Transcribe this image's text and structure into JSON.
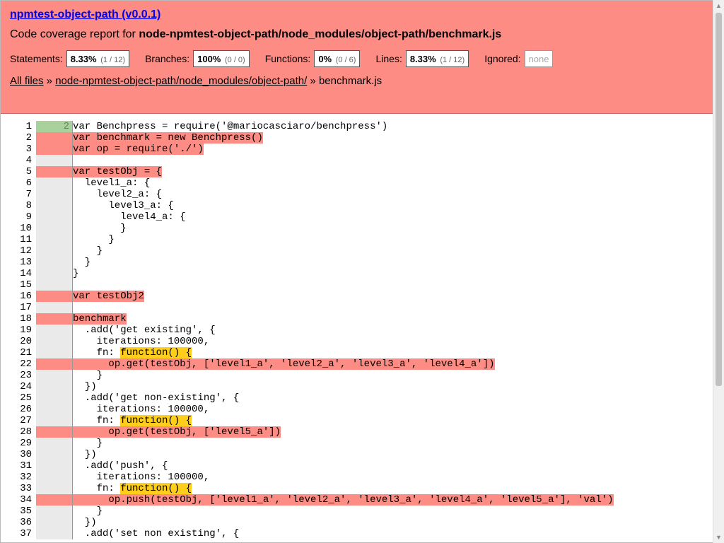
{
  "header": {
    "title": "npmtest-object-path (v0.0.1)",
    "report_prefix": "Code coverage report for ",
    "report_path": "node-npmtest-object-path/node_modules/object-path/benchmark.js"
  },
  "stats": {
    "statements": {
      "label": "Statements:",
      "pct": "8.33%",
      "frac": "(1 / 12)"
    },
    "branches": {
      "label": "Branches:",
      "pct": "100%",
      "frac": "(0 / 0)"
    },
    "functions": {
      "label": "Functions:",
      "pct": "0%",
      "frac": "(0 / 6)"
    },
    "lines": {
      "label": "Lines:",
      "pct": "8.33%",
      "frac": "(1 / 12)"
    },
    "ignored": {
      "label": "Ignored:",
      "value": "none"
    }
  },
  "breadcrumb": {
    "all_files": "All files",
    "sep1": " » ",
    "dir": "node-npmtest-object-path/node_modules/object-path/",
    "sep2": " » ",
    "file": "benchmark.js"
  },
  "colors": {
    "header_bg": "#fc8c84",
    "uncovered": "#fc8c84",
    "covered": "#a8d19b",
    "fn_uncovered": "#ffce1c",
    "link": "#0000ee"
  },
  "code_lines": [
    {
      "n": "1",
      "hits": "2",
      "status": "covered",
      "segs": [
        {
          "t": "var Benchpress = require('@mariocasciaro/benchpress')",
          "h": ""
        }
      ]
    },
    {
      "n": "2",
      "hits": "",
      "status": "uncovered",
      "segs": [
        {
          "t": "var benchmark = new Benchpress()",
          "h": "red"
        }
      ]
    },
    {
      "n": "3",
      "hits": "",
      "status": "uncovered",
      "segs": [
        {
          "t": "var op = require('./')",
          "h": "red"
        }
      ]
    },
    {
      "n": "4",
      "hits": "",
      "status": "skip",
      "segs": [
        {
          "t": "",
          "h": ""
        }
      ]
    },
    {
      "n": "5",
      "hits": "",
      "status": "uncovered",
      "segs": [
        {
          "t": "var testObj = {",
          "h": "red"
        }
      ]
    },
    {
      "n": "6",
      "hits": "",
      "status": "skip",
      "segs": [
        {
          "t": "  level1_a: {",
          "h": ""
        }
      ]
    },
    {
      "n": "7",
      "hits": "",
      "status": "skip",
      "segs": [
        {
          "t": "    level2_a: {",
          "h": ""
        }
      ]
    },
    {
      "n": "8",
      "hits": "",
      "status": "skip",
      "segs": [
        {
          "t": "      level3_a: {",
          "h": ""
        }
      ]
    },
    {
      "n": "9",
      "hits": "",
      "status": "skip",
      "segs": [
        {
          "t": "        level4_a: {",
          "h": ""
        }
      ]
    },
    {
      "n": "10",
      "hits": "",
      "status": "skip",
      "segs": [
        {
          "t": "        }",
          "h": ""
        }
      ]
    },
    {
      "n": "11",
      "hits": "",
      "status": "skip",
      "segs": [
        {
          "t": "      }",
          "h": ""
        }
      ]
    },
    {
      "n": "12",
      "hits": "",
      "status": "skip",
      "segs": [
        {
          "t": "    }",
          "h": ""
        }
      ]
    },
    {
      "n": "13",
      "hits": "",
      "status": "skip",
      "segs": [
        {
          "t": "  }",
          "h": ""
        }
      ]
    },
    {
      "n": "14",
      "hits": "",
      "status": "skip",
      "segs": [
        {
          "t": "}",
          "h": ""
        }
      ]
    },
    {
      "n": "15",
      "hits": "",
      "status": "skip",
      "segs": [
        {
          "t": "",
          "h": ""
        }
      ]
    },
    {
      "n": "16",
      "hits": "",
      "status": "uncovered",
      "segs": [
        {
          "t": "var testObj2",
          "h": "red"
        }
      ]
    },
    {
      "n": "17",
      "hits": "",
      "status": "skip",
      "segs": [
        {
          "t": "",
          "h": ""
        }
      ]
    },
    {
      "n": "18",
      "hits": "",
      "status": "uncovered",
      "segs": [
        {
          "t": "benchmark",
          "h": "red"
        }
      ]
    },
    {
      "n": "19",
      "hits": "",
      "status": "skip",
      "segs": [
        {
          "t": "  .add('get existing', {",
          "h": ""
        }
      ]
    },
    {
      "n": "20",
      "hits": "",
      "status": "skip",
      "segs": [
        {
          "t": "    iterations: 100000,",
          "h": ""
        }
      ]
    },
    {
      "n": "21",
      "hits": "",
      "status": "skip",
      "segs": [
        {
          "t": "    fn: ",
          "h": ""
        },
        {
          "t": "function() {",
          "h": "yellow"
        }
      ]
    },
    {
      "n": "22",
      "hits": "",
      "status": "uncovered",
      "segs": [
        {
          "t": "      op.get(testObj, ['level1_a', 'level2_a', 'level3_a', 'level4_a'])",
          "h": "red"
        }
      ]
    },
    {
      "n": "23",
      "hits": "",
      "status": "skip",
      "segs": [
        {
          "t": "    }",
          "h": ""
        }
      ]
    },
    {
      "n": "24",
      "hits": "",
      "status": "skip",
      "segs": [
        {
          "t": "  })",
          "h": ""
        }
      ]
    },
    {
      "n": "25",
      "hits": "",
      "status": "skip",
      "segs": [
        {
          "t": "  .add('get non-existing', {",
          "h": ""
        }
      ]
    },
    {
      "n": "26",
      "hits": "",
      "status": "skip",
      "segs": [
        {
          "t": "    iterations: 100000,",
          "h": ""
        }
      ]
    },
    {
      "n": "27",
      "hits": "",
      "status": "skip",
      "segs": [
        {
          "t": "    fn: ",
          "h": ""
        },
        {
          "t": "function() {",
          "h": "yellow"
        }
      ]
    },
    {
      "n": "28",
      "hits": "",
      "status": "uncovered",
      "segs": [
        {
          "t": "      op.get(testObj, ['level5_a'])",
          "h": "red"
        }
      ]
    },
    {
      "n": "29",
      "hits": "",
      "status": "skip",
      "segs": [
        {
          "t": "    }",
          "h": ""
        }
      ]
    },
    {
      "n": "30",
      "hits": "",
      "status": "skip",
      "segs": [
        {
          "t": "  })",
          "h": ""
        }
      ]
    },
    {
      "n": "31",
      "hits": "",
      "status": "skip",
      "segs": [
        {
          "t": "  .add('push', {",
          "h": ""
        }
      ]
    },
    {
      "n": "32",
      "hits": "",
      "status": "skip",
      "segs": [
        {
          "t": "    iterations: 100000,",
          "h": ""
        }
      ]
    },
    {
      "n": "33",
      "hits": "",
      "status": "skip",
      "segs": [
        {
          "t": "    fn: ",
          "h": ""
        },
        {
          "t": "function() {",
          "h": "yellow"
        }
      ]
    },
    {
      "n": "34",
      "hits": "",
      "status": "uncovered",
      "segs": [
        {
          "t": "      op.push(testObj, ['level1_a', 'level2_a', 'level3_a', 'level4_a', 'level5_a'], 'val')",
          "h": "red"
        }
      ]
    },
    {
      "n": "35",
      "hits": "",
      "status": "skip",
      "segs": [
        {
          "t": "    }",
          "h": ""
        }
      ]
    },
    {
      "n": "36",
      "hits": "",
      "status": "skip",
      "segs": [
        {
          "t": "  })",
          "h": ""
        }
      ]
    },
    {
      "n": "37",
      "hits": "",
      "status": "skip",
      "segs": [
        {
          "t": "  .add('set non existing', {",
          "h": ""
        }
      ]
    }
  ]
}
